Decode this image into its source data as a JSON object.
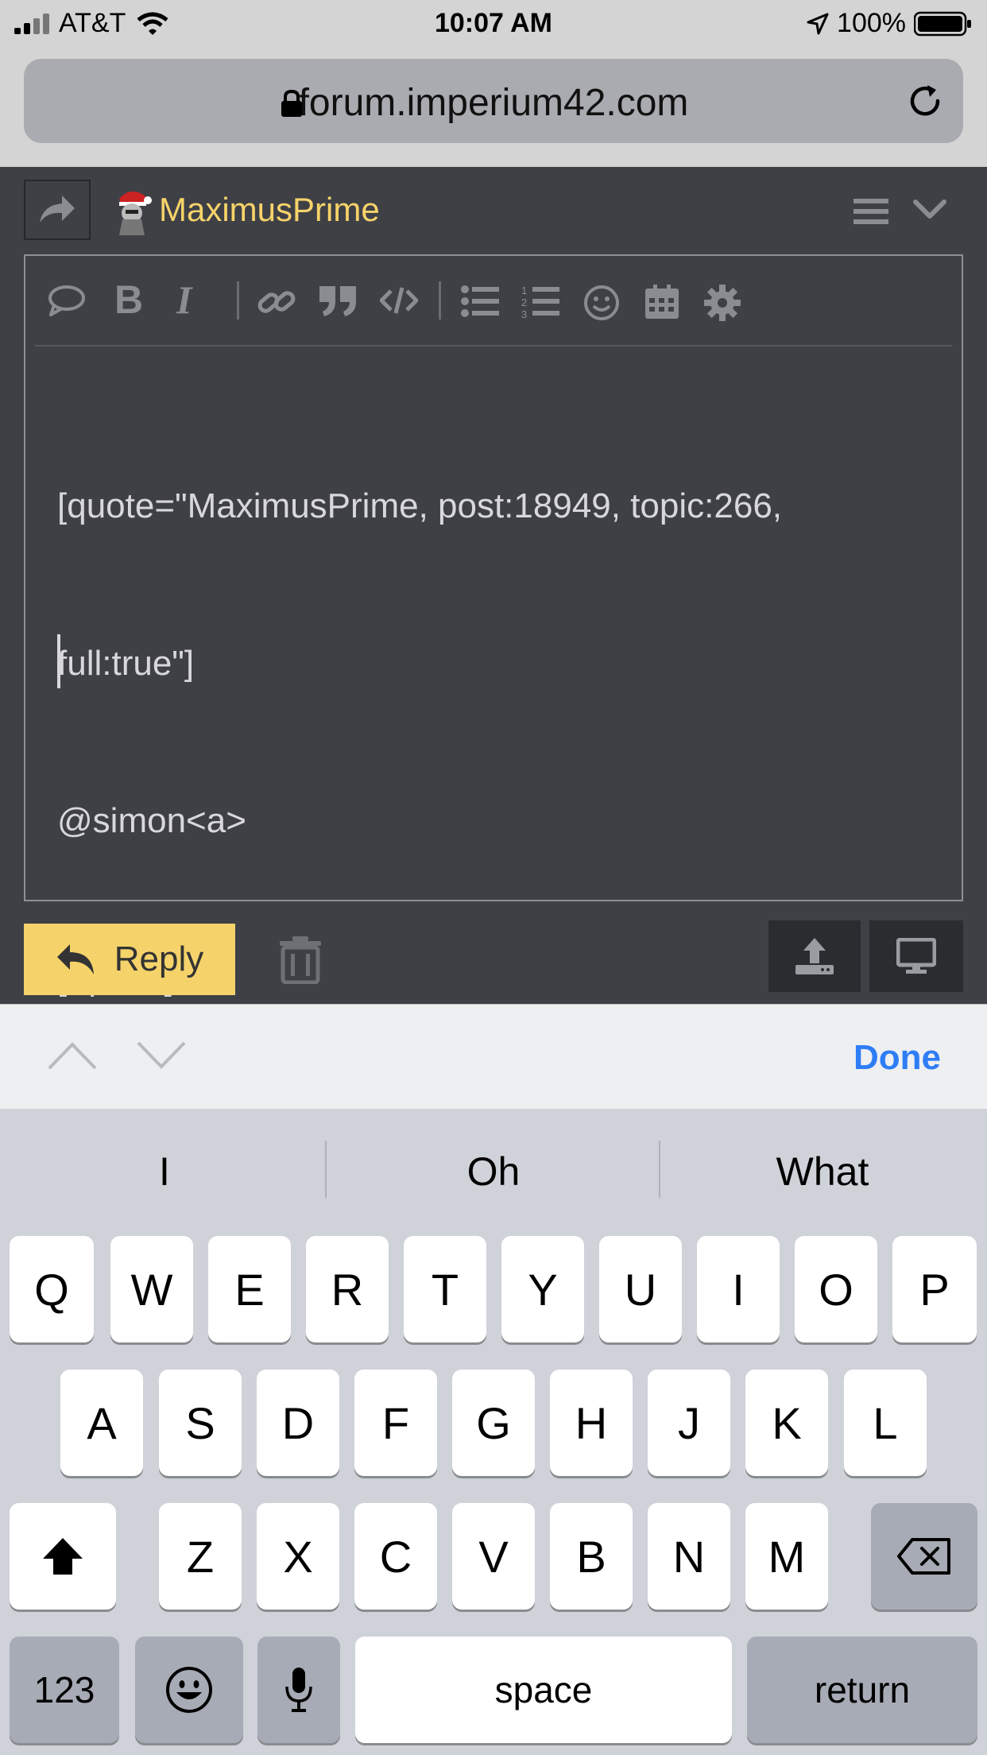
{
  "status_bar": {
    "carrier": "AT&T",
    "time": "10:07 AM",
    "battery": "100%"
  },
  "browser": {
    "url": "forum.imperium42.com"
  },
  "composer": {
    "username": "MaximusPrime",
    "editor_lines": [
      "[quote=\"MaximusPrime, post:18949, topic:266,",
      "full:true\"]",
      "@simon<a>",
      "[/quote]"
    ],
    "reply_label": "Reply"
  },
  "accessory": {
    "done_label": "Done"
  },
  "keyboard": {
    "suggestions": [
      "I",
      "Oh",
      "What"
    ],
    "row1": [
      "Q",
      "W",
      "E",
      "R",
      "T",
      "Y",
      "U",
      "I",
      "O",
      "P"
    ],
    "row2": [
      "A",
      "S",
      "D",
      "F",
      "G",
      "H",
      "J",
      "K",
      "L"
    ],
    "row3": [
      "Z",
      "X",
      "C",
      "V",
      "B",
      "N",
      "M"
    ],
    "numbers_label": "123",
    "space_label": "space",
    "return_label": "return"
  },
  "colors": {
    "accent_yellow": "#f5d36a",
    "username_color": "#f6d36a",
    "done_blue": "#2f7df6",
    "composer_bg": "#3e4046"
  }
}
